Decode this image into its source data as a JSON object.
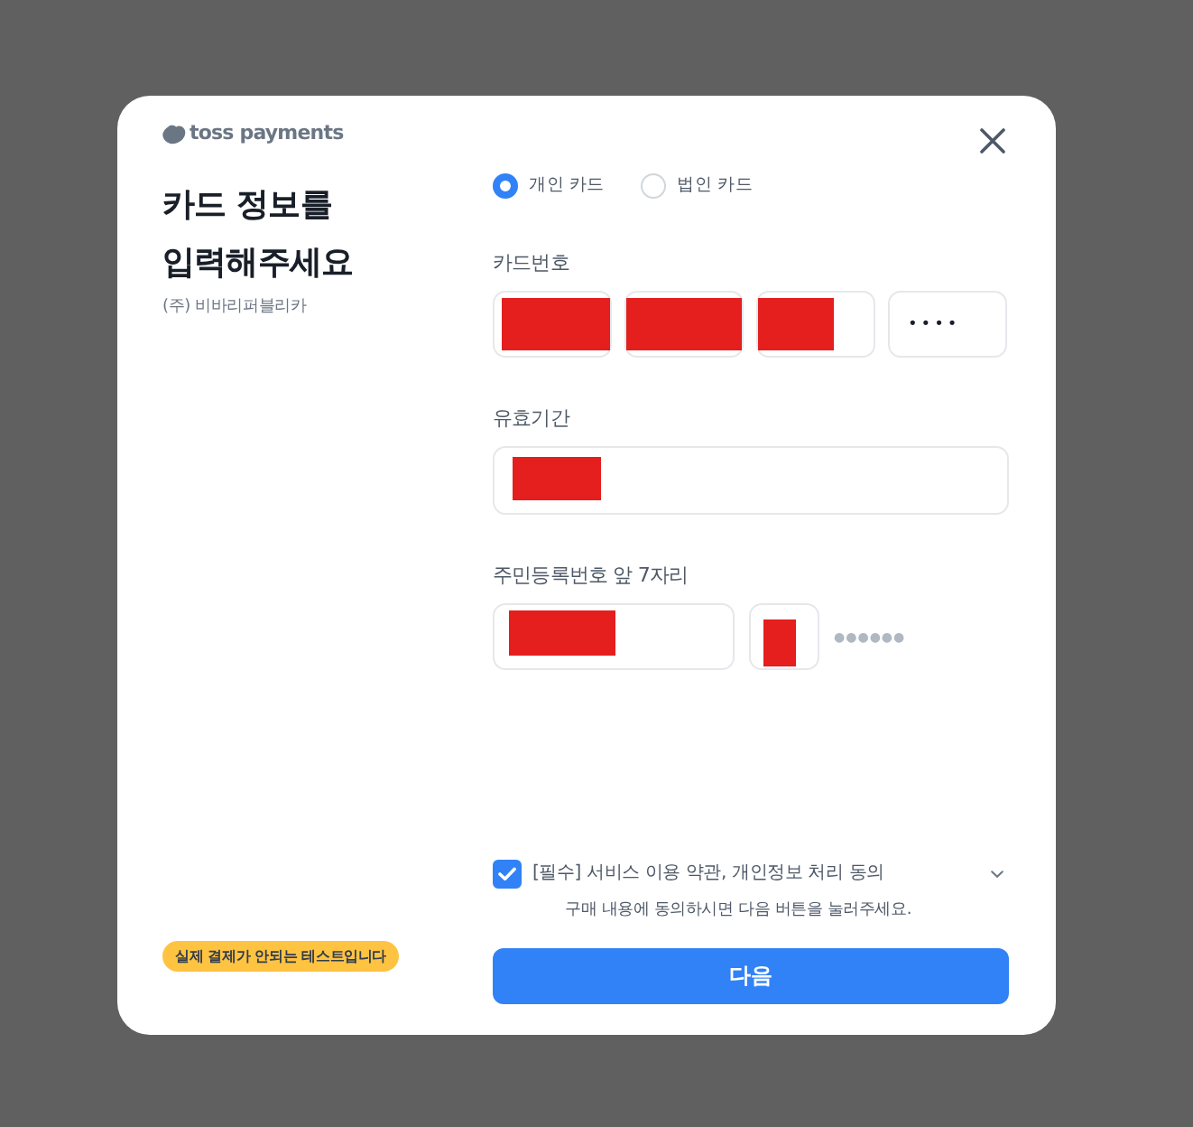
{
  "brand": {
    "logo_text": "toss payments"
  },
  "heading": {
    "title": "카드 정보를 입력해주세요",
    "merchant": "(주) 비바리퍼블리카"
  },
  "test_badge": "실제 결제가 안되는 테스트입니다",
  "card_types": [
    {
      "label": "개인 카드",
      "selected": true
    },
    {
      "label": "법인 카드",
      "selected": false
    }
  ],
  "card_number": {
    "label": "카드번호",
    "masked_value": "••••"
  },
  "expiry": {
    "label": "유효기간"
  },
  "id_number": {
    "label": "주민등록번호 앞 7자리",
    "masked_rest": "●●●●●●"
  },
  "agreement": {
    "checked": true,
    "expanded": false,
    "label": "[필수] 서비스 이용 약관, 개인정보 처리 동의"
  },
  "notice": "구매 내용에 동의하시면 다음 버튼을 눌러주세요.",
  "submit_button": "다음"
}
